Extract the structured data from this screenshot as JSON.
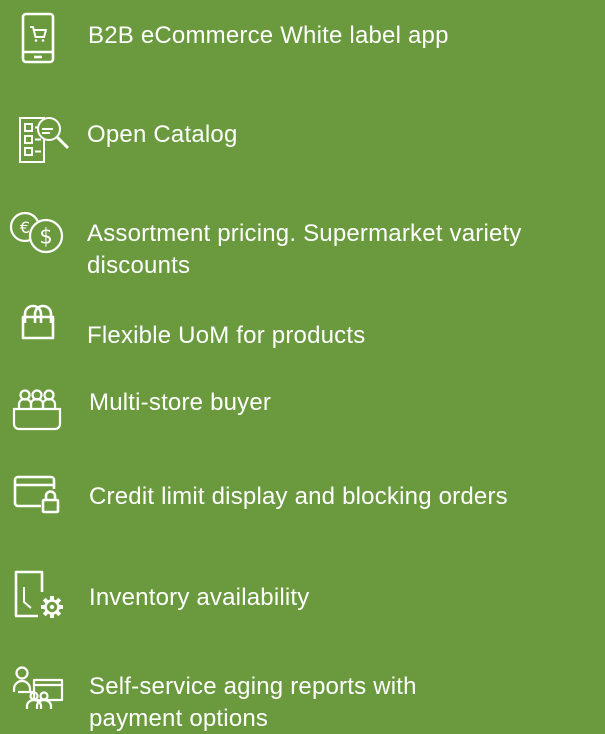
{
  "features": [
    {
      "icon": "mobile-cart-icon",
      "label": "B2B eCommerce White label app"
    },
    {
      "icon": "catalog-search-icon",
      "label": "Open Catalog"
    },
    {
      "icon": "currency-exchange-icon",
      "label": "Assortment pricing. Supermarket variety",
      "label_line2": "discounts"
    },
    {
      "icon": "shopping-bag-icon",
      "label": "Flexible UoM for products"
    },
    {
      "icon": "multi-store-people-icon",
      "label": "Multi-store buyer"
    },
    {
      "icon": "credit-lock-icon",
      "label": "Credit limit display and blocking orders"
    },
    {
      "icon": "inventory-gear-icon",
      "label": "Inventory availability"
    },
    {
      "icon": "aging-report-people-icon",
      "label": "Self-service aging reports with",
      "label_line2": "payment options"
    }
  ],
  "colors": {
    "background": "#6b9a3e",
    "foreground": "#ffffff"
  }
}
